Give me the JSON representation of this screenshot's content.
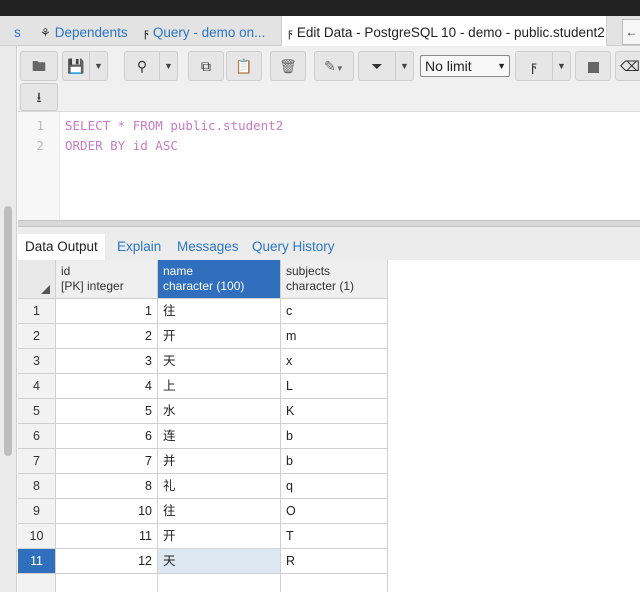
{
  "tabs": [
    {
      "label": "s",
      "icon": "",
      "active": false
    },
    {
      "label": "Dependents",
      "icon": "dependents-icon",
      "active": false
    },
    {
      "label": "Query - demo on...",
      "icon": "lightning-icon",
      "active": false
    },
    {
      "label": "Edit Data - PostgreSQL 10 - demo - public.student2",
      "icon": "lightning-icon",
      "active": true
    }
  ],
  "toolbar": {
    "limit_value": "No limit"
  },
  "editor": {
    "line_numbers": [
      "1",
      "2"
    ],
    "lines": [
      "SELECT * FROM public.student2",
      "ORDER BY id ASC"
    ]
  },
  "result_tabs": [
    "Data Output",
    "Explain",
    "Messages",
    "Query History"
  ],
  "grid": {
    "columns": [
      {
        "name": "id",
        "type": "[PK] integer"
      },
      {
        "name": "name",
        "type": "character (100)"
      },
      {
        "name": "subjects",
        "type": "character (1)"
      }
    ],
    "selected_column": 1,
    "selected_row": 10,
    "rows": [
      {
        "num": "1",
        "id": "1",
        "name": "往",
        "subjects": "c"
      },
      {
        "num": "2",
        "id": "2",
        "name": "开",
        "subjects": "m"
      },
      {
        "num": "3",
        "id": "3",
        "name": "天",
        "subjects": "x"
      },
      {
        "num": "4",
        "id": "4",
        "name": "上",
        "subjects": "L"
      },
      {
        "num": "5",
        "id": "5",
        "name": "水",
        "subjects": "K"
      },
      {
        "num": "6",
        "id": "6",
        "name": "连",
        "subjects": "b"
      },
      {
        "num": "7",
        "id": "7",
        "name": "并",
        "subjects": "b"
      },
      {
        "num": "8",
        "id": "8",
        "name": "礼",
        "subjects": "q"
      },
      {
        "num": "9",
        "id": "10",
        "name": "往",
        "subjects": "O"
      },
      {
        "num": "10",
        "id": "11",
        "name": "开",
        "subjects": "T"
      },
      {
        "num": "11",
        "id": "12",
        "name": "天",
        "subjects": "R"
      }
    ]
  },
  "colors": {
    "accent": "#2f6fbd",
    "link": "#2c76c7",
    "keyword": "#c87cc4"
  }
}
